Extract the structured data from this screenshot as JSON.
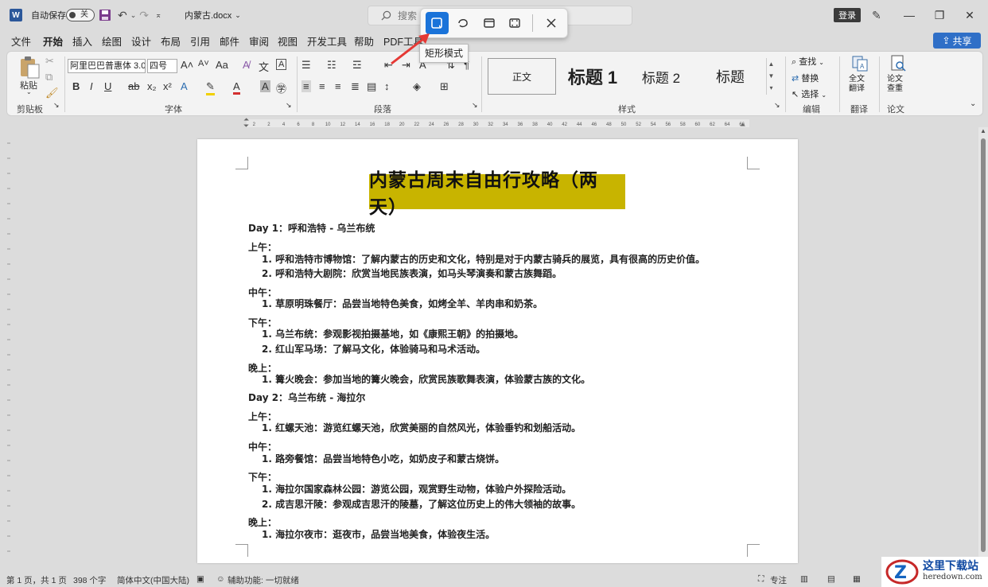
{
  "titlebar": {
    "autosave_label": "自动保存",
    "autosave_state": "关",
    "doc_name": "内蒙古.docx",
    "search_placeholder": "搜索",
    "login_label": "登录"
  },
  "snip_toolbar": {
    "tooltip": "矩形模式",
    "active_mode": "rectangle",
    "accent_color": "#1a73d9"
  },
  "tabs": [
    "文件",
    "开始",
    "插入",
    "绘图",
    "设计",
    "布局",
    "引用",
    "邮件",
    "审阅",
    "视图",
    "开发工具",
    "帮助",
    "PDF工具"
  ],
  "active_tab": "开始",
  "share_label": "共享",
  "ribbon": {
    "clipboard": {
      "paste": "粘贴",
      "group": "剪贴板"
    },
    "font": {
      "family": "阿里巴巴普惠体 3.0",
      "size": "四号",
      "group": "字体"
    },
    "paragraph": {
      "group": "段落"
    },
    "styles": {
      "normal": "正文",
      "h1": "标题 1",
      "h2": "标题 2",
      "title": "标题",
      "group": "样式"
    },
    "editing": {
      "find": "查找",
      "replace": "替换",
      "select": "选择",
      "group": "编辑"
    },
    "translate": {
      "btn": "全文翻译",
      "group": "翻译"
    },
    "paper": {
      "btn": "论文查重",
      "group": "论文"
    }
  },
  "ruler_ticks": [
    "2",
    "2",
    "4",
    "6",
    "8",
    "10",
    "12",
    "14",
    "16",
    "18",
    "20",
    "22",
    "24",
    "26",
    "28",
    "30",
    "32",
    "34",
    "36",
    "38",
    "40",
    "42",
    "44",
    "46",
    "48",
    "50",
    "52",
    "54",
    "56",
    "58",
    "60",
    "62",
    "64",
    "66"
  ],
  "document": {
    "title": "内蒙古周末自由行攻略（两天）",
    "title_highlight": "#c8b400",
    "lines": [
      "Day 1：呼和浩特 - 乌兰布统",
      "上午：",
      "1. 呼和浩特市博物馆：了解内蒙古的历史和文化，特别是对于内蒙古骑兵的展览，具有很高的历史价值。",
      "2. 呼和浩特大剧院：欣赏当地民族表演，如马头琴演奏和蒙古族舞蹈。",
      "中午：",
      "1. 草原明珠餐厅：品尝当地特色美食，如烤全羊、羊肉串和奶茶。",
      "下午：",
      "1. 乌兰布统：参观影视拍摄基地，如《康熙王朝》的拍摄地。",
      "2. 红山军马场：了解马文化，体验骑马和马术活动。",
      "晚上：",
      "1. 篝火晚会：参加当地的篝火晚会，欣赏民族歌舞表演，体验蒙古族的文化。",
      "Day 2：乌兰布统 - 海拉尔",
      "上午：",
      "1. 红螺天池：游览红螺天池，欣赏美丽的自然风光，体验垂钓和划船活动。",
      "中午：",
      "1. 路旁餐馆：品尝当地特色小吃，如奶皮子和蒙古烧饼。",
      "下午：",
      "1. 海拉尔国家森林公园：游览公园，观赏野生动物，体验户外探险活动。",
      "2. 成吉思汗陵：参观成吉思汗的陵墓，了解这位历史上的伟大领袖的故事。",
      "晚上：",
      "1. 海拉尔夜市：逛夜市，品尝当地美食，体验夜生活。"
    ]
  },
  "statusbar": {
    "page": "第 1 页，共 1 页",
    "words": "398 个字",
    "language": "简体中文(中国大陆)",
    "accessibility": "辅助功能: 一切就绪",
    "focus": "专注"
  },
  "watermark": {
    "main": "这里下载站",
    "url": "heredown.com"
  }
}
